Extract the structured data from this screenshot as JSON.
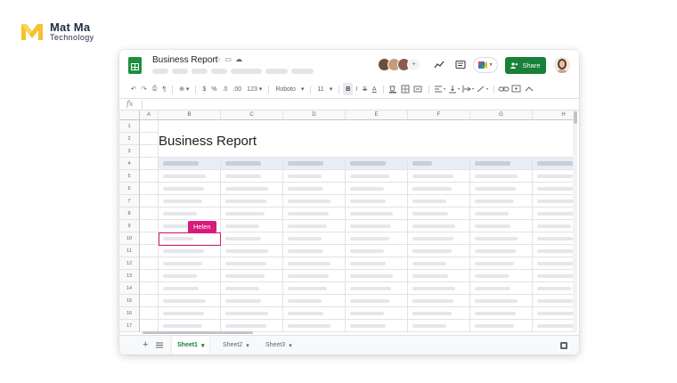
{
  "brand": {
    "name": "Mat Ma",
    "sub": "Technology",
    "color": "#f6c12a"
  },
  "doc": {
    "title": "Business Report",
    "title_icons": "☆ ▭ ☁"
  },
  "toolbar": {
    "zoom": "⊕ ▾",
    "currency": "$",
    "percent": "%",
    "dec_less": ".0",
    "dec_more": ".00",
    "format": "123 ▾",
    "font": "Roboto",
    "font_caret": "▾",
    "size": "11",
    "size_caret": "▾",
    "bold": "B",
    "italic": "I",
    "strike": "S",
    "underline": "A"
  },
  "formula": {
    "fx": "fx"
  },
  "sheet": {
    "title": "Business Report",
    "columns": [
      "A",
      "B",
      "C",
      "D",
      "E",
      "F",
      "G",
      "H"
    ],
    "rows": [
      "1",
      "2",
      "3",
      "4",
      "5",
      "6",
      "7",
      "8",
      "9",
      "10",
      "11",
      "12",
      "13",
      "14",
      "15",
      "16",
      "17"
    ]
  },
  "collaborator": {
    "name": "Helen",
    "color": "#d81b7a"
  },
  "actions": {
    "share": "Share"
  },
  "tabs": [
    {
      "label": "Sheet1",
      "caret": "▾",
      "active": true
    },
    {
      "label": "Sheet2",
      "caret": "▾",
      "active": false
    },
    {
      "label": "Sheet3",
      "caret": "▾",
      "active": false
    }
  ],
  "icons": {
    "add_sheet": "+",
    "more_avatars": "+",
    "undo": "↶",
    "redo": "↷",
    "print": "⎙",
    "paint": "¶"
  }
}
